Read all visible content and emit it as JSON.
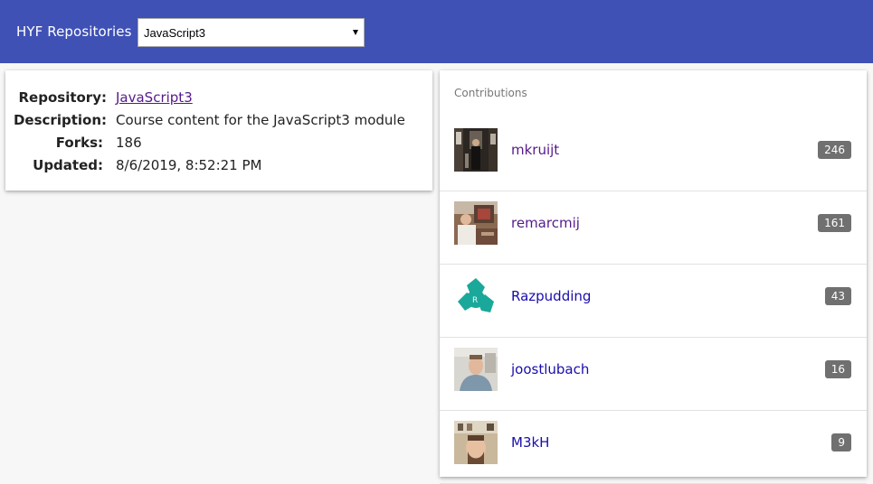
{
  "header": {
    "title": "HYF Repositories",
    "select": {
      "value": "JavaScript3",
      "bg_color": "#3f51b5"
    }
  },
  "repo": {
    "repository_label": "Repository:",
    "repository_value": "JavaScript3",
    "description_label": "Description:",
    "description_value": "Course content for the JavaScript3 module",
    "forks_label": "Forks:",
    "forks_value": "186",
    "updated_label": "Updated:",
    "updated_value": "8/6/2019, 8:52:21 PM"
  },
  "contributions": {
    "heading": "Contributions",
    "items": [
      {
        "login": "mkruijt",
        "count": "246",
        "avatar": "photo-avatar"
      },
      {
        "login": "remarcmij",
        "count": "161",
        "avatar": "photo-avatar"
      },
      {
        "login": "Razpudding",
        "count": "43",
        "avatar": "logo-avatar"
      },
      {
        "login": "joostlubach",
        "count": "16",
        "avatar": "photo-avatar"
      },
      {
        "login": "M3kH",
        "count": "9",
        "avatar": "photo-avatar"
      }
    ]
  }
}
